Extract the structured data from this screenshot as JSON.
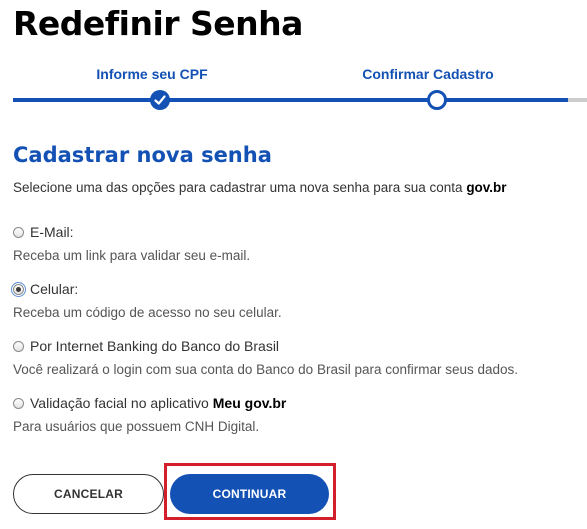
{
  "page": {
    "title": "Redefinir Senha"
  },
  "stepper": {
    "steps": [
      {
        "label": "Informe seu CPF",
        "state": "completed"
      },
      {
        "label": "Confirmar Cadastro",
        "state": "current"
      }
    ]
  },
  "section": {
    "title": "Cadastrar nova senha",
    "intro": "Selecione uma das opções para cadastrar uma nova senha para sua conta",
    "intro_brand": "gov.br"
  },
  "options": [
    {
      "label": "E-Mail:",
      "description": "Receba um link para validar seu e-mail.",
      "selected": false
    },
    {
      "label": "Celular:",
      "description": "Receba um código de acesso no seu celular.",
      "selected": true
    },
    {
      "label": "Por Internet Banking do Banco do Brasil",
      "description": "Você realizará o login com sua conta do Banco do Brasil para confirmar seus dados.",
      "selected": false
    },
    {
      "label": "Validação facial no aplicativo",
      "label_brand": "Meu gov.br",
      "description": "Para usuários que possuem CNH Digital.",
      "selected": false
    }
  ],
  "actions": {
    "cancel_label": "CANCELAR",
    "continue_label": "CONTINUAR"
  },
  "colors": {
    "primary": "#1351b4",
    "highlight": "#d21f2b",
    "track_rest": "#cccccc"
  }
}
